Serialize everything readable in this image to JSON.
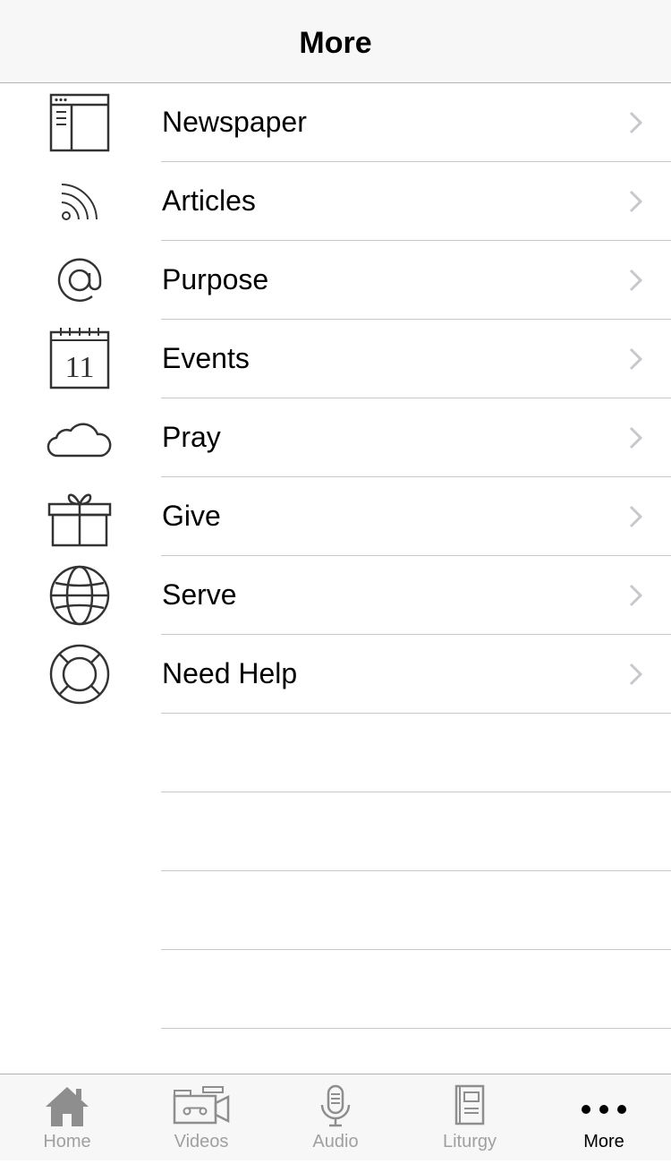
{
  "navbar": {
    "title": "More"
  },
  "menu": [
    {
      "label": "Newspaper",
      "icon": "newspaper-icon"
    },
    {
      "label": "Articles",
      "icon": "rss-icon"
    },
    {
      "label": "Purpose",
      "icon": "at-sign-icon"
    },
    {
      "label": "Events",
      "icon": "calendar-icon",
      "icon_text": "11"
    },
    {
      "label": "Pray",
      "icon": "cloud-icon"
    },
    {
      "label": "Give",
      "icon": "gift-icon"
    },
    {
      "label": "Serve",
      "icon": "globe-icon"
    },
    {
      "label": "Need Help",
      "icon": "lifebuoy-icon"
    }
  ],
  "tabs": [
    {
      "label": "Home",
      "icon": "home-icon",
      "active": false
    },
    {
      "label": "Videos",
      "icon": "video-camera-icon",
      "active": false
    },
    {
      "label": "Audio",
      "icon": "microphone-icon",
      "active": false
    },
    {
      "label": "Liturgy",
      "icon": "book-icon",
      "active": false
    },
    {
      "label": "More",
      "icon": "more-dots-icon",
      "active": true
    }
  ],
  "colors": {
    "icon_stroke": "#333333",
    "chevron": "#c7c7cc",
    "tab_inactive": "#a0a0a0",
    "tab_active": "#000000"
  }
}
